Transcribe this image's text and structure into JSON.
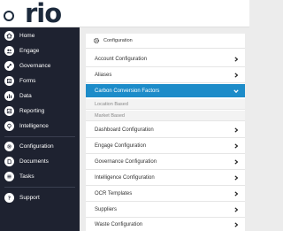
{
  "brand": {
    "logo_text": "rio",
    "colors": {
      "dark": "#1c2a3c",
      "sidebar": "#1e2230",
      "accent": "#1d8cc9"
    }
  },
  "sidebar": {
    "items": [
      {
        "label": "Home",
        "icon": "home-icon"
      },
      {
        "label": "Engage",
        "icon": "engage-icon"
      },
      {
        "label": "Governance",
        "icon": "governance-icon"
      },
      {
        "label": "Forms",
        "icon": "forms-icon"
      },
      {
        "label": "Data",
        "icon": "data-icon"
      },
      {
        "label": "Reporting",
        "icon": "reporting-icon"
      },
      {
        "label": "Intelligence",
        "icon": "intelligence-icon"
      },
      {
        "label": "Configuration",
        "icon": "gear-icon"
      },
      {
        "label": "Documents",
        "icon": "documents-icon"
      },
      {
        "label": "Tasks",
        "icon": "tasks-icon"
      },
      {
        "label": "Support",
        "icon": "help-icon"
      }
    ]
  },
  "main": {
    "title": "Configuration",
    "rows": [
      {
        "label": "Account Configuration"
      },
      {
        "label": "Aliases"
      },
      {
        "label": "Carbon Conversion Factors",
        "expanded": true,
        "children": [
          {
            "label": "Location Based"
          },
          {
            "label": "Market Based"
          }
        ]
      },
      {
        "label": "Dashboard Configuration"
      },
      {
        "label": "Engage Configuration"
      },
      {
        "label": "Governance Configuration"
      },
      {
        "label": "Intelligence Configuration"
      },
      {
        "label": "OCR Templates"
      },
      {
        "label": "Suppliers"
      },
      {
        "label": "Waste Configuration"
      }
    ]
  }
}
